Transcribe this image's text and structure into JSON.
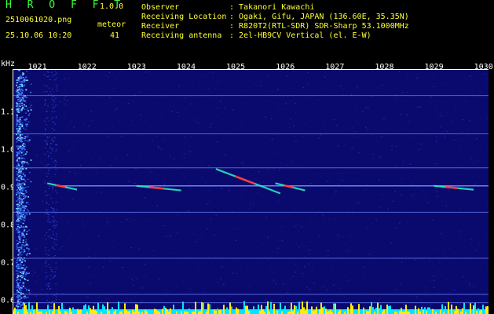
{
  "header": {
    "title": "H R O F F T",
    "version": "1.0.0",
    "filename": "2510061020.png",
    "meteor_label": "meteor",
    "datetime": "25.10.06 10:20",
    "meteor_count": "41",
    "info": [
      {
        "label": "Observer",
        "value": ": Takanori Kawachi"
      },
      {
        "label": "Receiving Location",
        "value": ": Ogaki, Gifu, JAPAN (136.60E, 35.35N)"
      },
      {
        "label": "Receiver",
        "value": ": R820T2(RTL-SDR) SDR-Sharp 53.1000MHz"
      },
      {
        "label": "Receiving antenna",
        "value": ": 2el-HB9CV Vertical (el. E-W)"
      }
    ]
  },
  "chart_data": {
    "type": "heatmap",
    "ylabel": "kHz",
    "x_ticks": [
      "1021",
      "1022",
      "1023",
      "1024",
      "1025",
      "1026",
      "1027",
      "1028",
      "1029",
      "1030"
    ],
    "y_ticks": [
      "1.1",
      "1.0",
      "0.9",
      "0.8",
      "0.7",
      "0.6"
    ],
    "x_range": [
      1020.5,
      1030.1
    ],
    "y_range": [
      0.565,
      1.215
    ],
    "horizontal_lines_khz": [
      1.145,
      1.043,
      0.953,
      0.835,
      0.713,
      0.617,
      0.595
    ],
    "carrier_khz": 0.905,
    "meteor_echoes": [
      {
        "x0": 1021.2,
        "y0": 0.912,
        "x1": 1021.8,
        "y1": 0.895
      },
      {
        "x0": 1023.0,
        "y0": 0.905,
        "x1": 1023.9,
        "y1": 0.893
      },
      {
        "x0": 1024.6,
        "y0": 0.95,
        "x1": 1025.9,
        "y1": 0.885
      },
      {
        "x0": 1025.8,
        "y0": 0.912,
        "x1": 1026.4,
        "y1": 0.893
      },
      {
        "x0": 1029.0,
        "y0": 0.905,
        "x1": 1029.8,
        "y1": 0.895
      }
    ],
    "colors": {
      "background": "#0a0a6e",
      "noise": "#14148a",
      "line": "#6a80ff",
      "echo": "#ff3b3b",
      "echo_edge": "#2cf2c8",
      "floor_low": "#00e8ff",
      "floor_high": "#ffee00"
    }
  }
}
